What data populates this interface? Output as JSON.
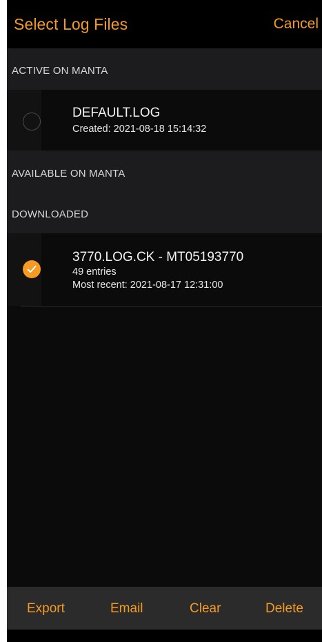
{
  "nav": {
    "title": "Select Log Files",
    "cancel_label": "Cancel"
  },
  "sections": {
    "active": {
      "header": "ACTIVE ON MANTA",
      "items": [
        {
          "title": "DEFAULT.LOG",
          "created": "Created: 2021-08-18 15:14:32",
          "selected": false
        }
      ]
    },
    "available": {
      "header": "AVAILABLE ON MANTA",
      "items": []
    },
    "downloaded": {
      "header": "DOWNLOADED",
      "items": [
        {
          "title": "3770.LOG.CK - MT05193770",
          "entries": "49 entries",
          "recent": "Most recent: 2021-08-17 12:31:00",
          "selected": true
        }
      ]
    }
  },
  "toolbar": {
    "export_label": "Export",
    "email_label": "Email",
    "clear_label": "Clear",
    "delete_label": "Delete"
  },
  "colors": {
    "accent": "#f59a23",
    "background": "#0b0b0b",
    "section_header_bg": "#1c1c1e",
    "toolbar_bg": "#2b2b2b"
  },
  "icons": {
    "unselected_radio": "empty-circle-icon",
    "selected_radio": "checkmark-circle-icon"
  }
}
